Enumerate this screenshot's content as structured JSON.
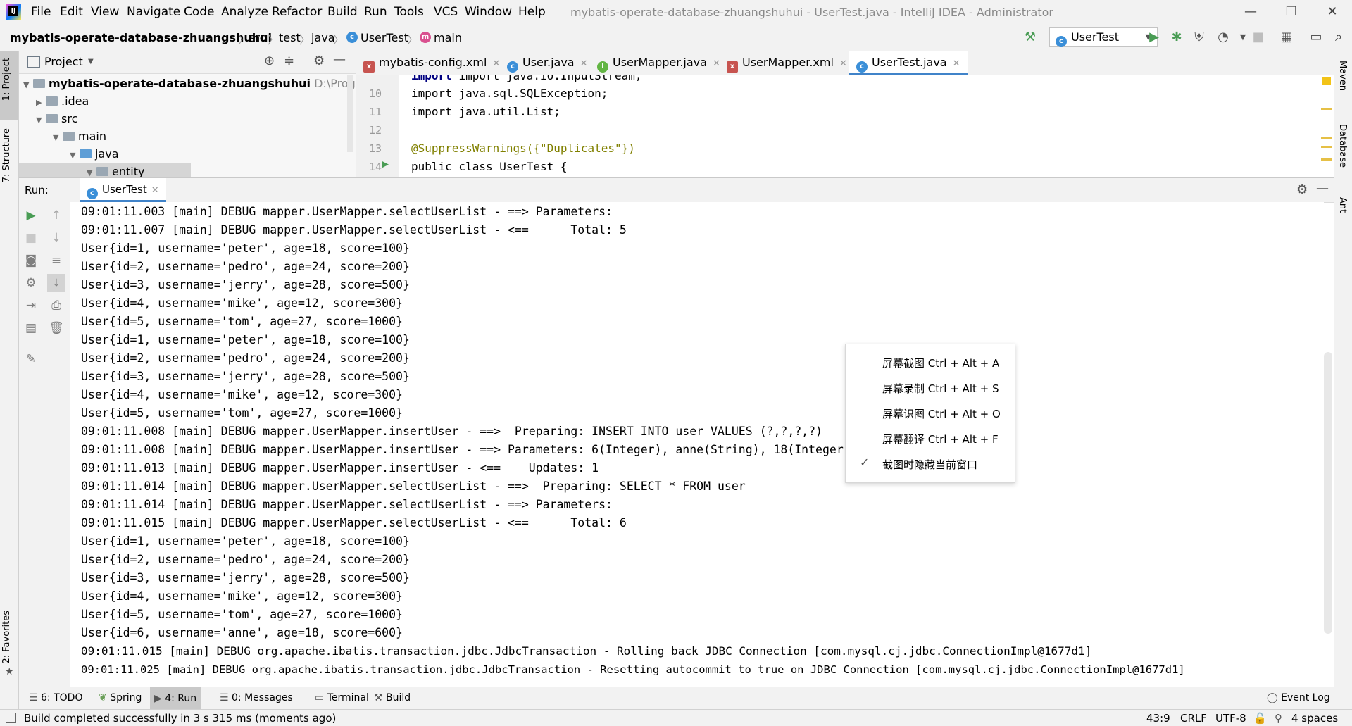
{
  "menu": [
    "File",
    "Edit",
    "View",
    "Navigate",
    "Code",
    "Analyze",
    "Refactor",
    "Build",
    "Run",
    "Tools",
    "VCS",
    "Window",
    "Help"
  ],
  "window_title": "mybatis-operate-database-zhuangshuhui - UserTest.java - IntelliJ IDEA - Administrator",
  "breadcrumbs": {
    "project": "mybatis-operate-database-zhuangshuhui",
    "src": "src",
    "test": "test",
    "java": "java",
    "class": "UserTest",
    "method": "main"
  },
  "run_config": "UserTest",
  "left_tabs": {
    "project": "1: Project",
    "structure": "7: Structure",
    "favorites": "2: Favorites"
  },
  "right_tabs": {
    "maven": "Maven",
    "database": "Database",
    "ant": "Ant"
  },
  "project_panel": {
    "title": "Project",
    "root": "mybatis-operate-database-zhuangshuhui",
    "root_path": "D:\\Program Fil",
    "items": [
      ".idea",
      "src",
      "main",
      "java",
      "entity"
    ]
  },
  "editor_tabs": [
    "mybatis-config.xml",
    "User.java",
    "UserMapper.java",
    "UserMapper.xml",
    "UserTest.java"
  ],
  "code": [
    {
      "num": "10",
      "text": "import java.sql.SQLException;"
    },
    {
      "num": "11",
      "text": "import java.util.List;"
    },
    {
      "num": "12",
      "text": ""
    },
    {
      "num": "13",
      "text": "@SuppressWarnings({\"Duplicates\"})"
    },
    {
      "num": "14",
      "text": "public class UserTest {"
    }
  ],
  "code_partial_top": "import java.io.InputStream;",
  "run": {
    "label": "Run:",
    "tab": "UserTest"
  },
  "console": [
    "09:01:11.003 [main] DEBUG mapper.UserMapper.selectUserList - ==> Parameters: ",
    "09:01:11.007 [main] DEBUG mapper.UserMapper.selectUserList - <==      Total: 5",
    "User{id=1, username='peter', age=18, score=100}",
    "User{id=2, username='pedro', age=24, score=200}",
    "User{id=3, username='jerry', age=28, score=500}",
    "User{id=4, username='mike', age=12, score=300}",
    "User{id=5, username='tom', age=27, score=1000}",
    "User{id=1, username='peter', age=18, score=100}",
    "User{id=2, username='pedro', age=24, score=200}",
    "User{id=3, username='jerry', age=28, score=500}",
    "User{id=4, username='mike', age=12, score=300}",
    "User{id=5, username='tom', age=27, score=1000}",
    "09:01:11.008 [main] DEBUG mapper.UserMapper.insertUser - ==>  Preparing: INSERT INTO user VALUES (?,?,?,?) ",
    "09:01:11.008 [main] DEBUG mapper.UserMapper.insertUser - ==> Parameters: 6(Integer), anne(String), 18(Integer), 600(Integer)",
    "09:01:11.013 [main] DEBUG mapper.UserMapper.insertUser - <==    Updates: 1",
    "09:01:11.014 [main] DEBUG mapper.UserMapper.selectUserList - ==>  Preparing: SELECT * FROM user ",
    "09:01:11.014 [main] DEBUG mapper.UserMapper.selectUserList - ==> Parameters: ",
    "09:01:11.015 [main] DEBUG mapper.UserMapper.selectUserList - <==      Total: 6",
    "User{id=1, username='peter', age=18, score=100}",
    "User{id=2, username='pedro', age=24, score=200}",
    "User{id=3, username='jerry', age=28, score=500}",
    "User{id=4, username='mike', age=12, score=300}",
    "User{id=5, username='tom', age=27, score=1000}",
    "User{id=6, username='anne', age=18, score=600}",
    "09:01:11.015 [main] DEBUG org.apache.ibatis.transaction.jdbc.JdbcTransaction - Rolling back JDBC Connection [com.mysql.cj.jdbc.ConnectionImpl@1677d1]",
    "09:01:11.025 [main] DEBUG org.apache.ibatis.transaction.jdbc.JdbcTransaction - Resetting autocommit to true on JDBC Connection [com.mysql.cj.jdbc.ConnectionImpl@1677d1]"
  ],
  "context_menu": [
    "屏幕截图 Ctrl + Alt + A",
    "屏幕录制 Ctrl + Alt + S",
    "屏幕识图 Ctrl + Alt + O",
    "屏幕翻译 Ctrl + Alt + F",
    "截图时隐藏当前窗口"
  ],
  "bottom_tabs": {
    "todo": "6: TODO",
    "spring": "Spring",
    "run": "4: Run",
    "messages": "0: Messages",
    "terminal": "Terminal",
    "build": "Build",
    "event_log": "Event Log"
  },
  "status": {
    "message": "Build completed successfully in 3 s 315 ms (moments ago)",
    "position": "43:9",
    "line_sep": "CRLF",
    "encoding": "UTF-8",
    "indent": "4 spaces"
  },
  "colors": {
    "accent": "#4083c9",
    "run_green": "#499c54",
    "keyword": "#000080",
    "annotation": "#808000",
    "string": "#008000"
  }
}
